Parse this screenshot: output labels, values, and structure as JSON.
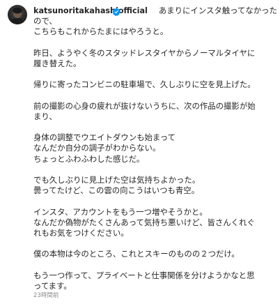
{
  "post": {
    "username": "katsunoritakahashiofficial",
    "caption_first_line": "あまりにインスタ触ってなかった",
    "lines": [
      "ので、",
      "こちらもこれからたまにはやろうと。",
      "",
      "昨日、ようやく冬のスタッドレスタイヤからノーマルタイヤに",
      "履き替えた。",
      "",
      "帰りに寄ったコンビニの駐車場で、久しぶりに空を見上げた。",
      "",
      "前の撮影の心身の疲れが抜けないうちに、次の作品の撮影が始",
      "まり、",
      "",
      "身体の調整でウエイトダウンも始まって",
      "なんだか自分の調子がわからない。",
      "ちょっとふわふわした感じだ。",
      "",
      "でも久しぶりに見上げた空は気持ちよかった。",
      "曇ってたけど、この雲の向こうはいつも青空。",
      "",
      "インスタ、アカウントをもう一つ増やそうかと。",
      "なんだか偽物がたくさんあって気持ち悪いけど、皆さんくれぐ",
      "れもお気をつけください。",
      "",
      "僕の本物は今のところ、これとスキーのものの２つだけ。",
      "",
      "もう一つ作って、プライベートと仕事関係を分けようかなと思",
      "ってます。"
    ],
    "timestamp": "23時間前"
  },
  "colors": {
    "text": "#262626",
    "secondary": "#8e8e8e",
    "verified": "#0095f6"
  },
  "icons": {
    "avatar": "profile-avatar",
    "verified": "verified-badge-icon"
  }
}
